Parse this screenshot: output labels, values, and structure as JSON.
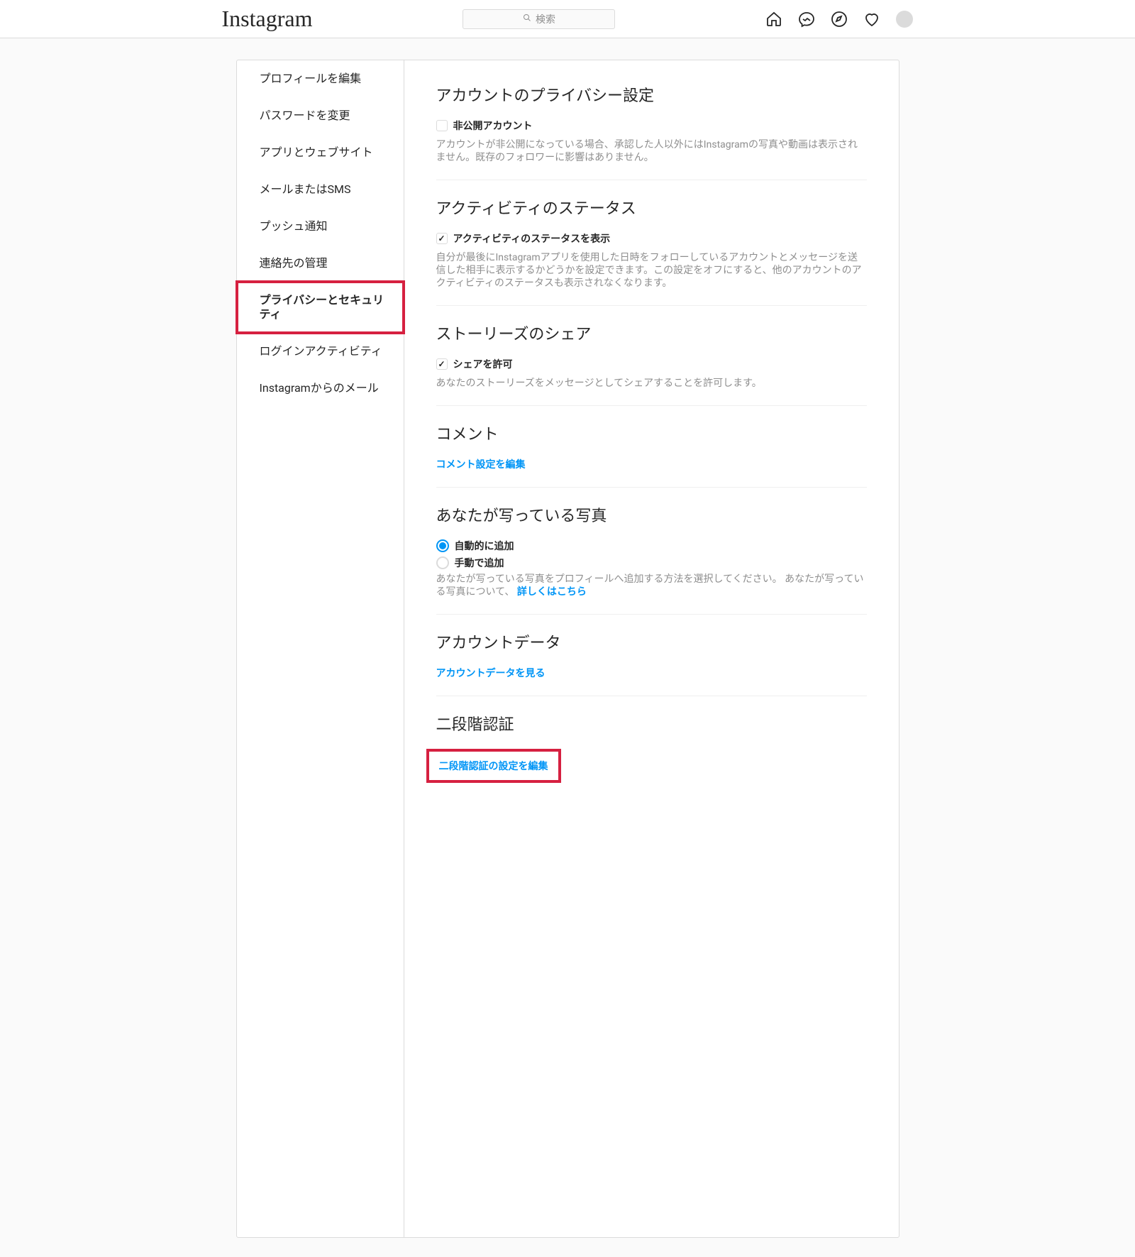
{
  "brand": "Instagram",
  "search": {
    "placeholder": "検索"
  },
  "sidebar": {
    "items": [
      {
        "label": "プロフィールを編集",
        "active": false
      },
      {
        "label": "パスワードを変更",
        "active": false
      },
      {
        "label": "アプリとウェブサイト",
        "active": false
      },
      {
        "label": "メールまたはSMS",
        "active": false
      },
      {
        "label": "プッシュ通知",
        "active": false
      },
      {
        "label": "連絡先の管理",
        "active": false
      },
      {
        "label": "プライバシーとセキュリティ",
        "active": true,
        "highlight": true
      },
      {
        "label": "ログインアクティビティ",
        "active": false
      },
      {
        "label": "Instagramからのメール",
        "active": false
      }
    ]
  },
  "sections": {
    "privacy": {
      "title": "アカウントのプライバシー設定",
      "checkbox_label": "非公開アカウント",
      "checkbox_checked": false,
      "desc": "アカウントが非公開になっている場合、承認した人以外にはInstagramの写真や動画は表示されません。既存のフォロワーに影響はありません。"
    },
    "activity": {
      "title": "アクティビティのステータス",
      "checkbox_label": "アクティビティのステータスを表示",
      "checkbox_checked": true,
      "desc": "自分が最後にInstagramアプリを使用した日時をフォローしているアカウントとメッセージを送信した相手に表示するかどうかを設定できます。この設定をオフにすると、他のアカウントのアクティビティのステータスも表示されなくなります。"
    },
    "story": {
      "title": "ストーリーズのシェア",
      "checkbox_label": "シェアを許可",
      "checkbox_checked": true,
      "desc": "あなたのストーリーズをメッセージとしてシェアすることを許可します。"
    },
    "comments": {
      "title": "コメント",
      "link": "コメント設定を編集"
    },
    "photos": {
      "title": "あなたが写っている写真",
      "radio_auto": "自動的に追加",
      "radio_manual": "手動で追加",
      "selected": "auto",
      "desc_prefix": "あなたが写っている写真をプロフィールへ追加する方法を選択してください。 あなたが写っている写真について、",
      "learn_more": "詳しくはこちら"
    },
    "data": {
      "title": "アカウントデータ",
      "link": "アカウントデータを見る"
    },
    "two_factor": {
      "title": "二段階認証",
      "link": "二段階認証の設定を編集",
      "highlight": true
    }
  }
}
